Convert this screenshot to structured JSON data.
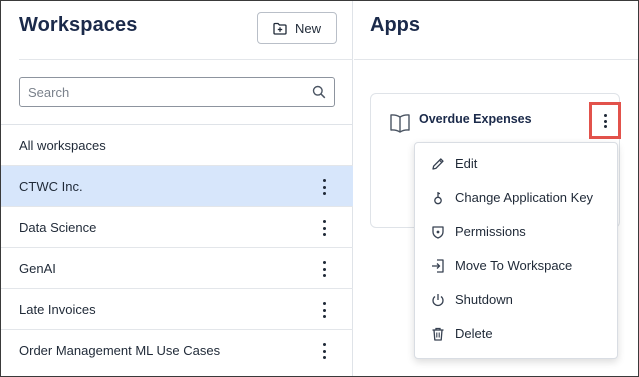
{
  "workspaces": {
    "title": "Workspaces",
    "new_button_label": "New",
    "search_placeholder": "Search",
    "items": [
      {
        "label": "All workspaces",
        "selected": false,
        "has_menu": false
      },
      {
        "label": "CTWC Inc.",
        "selected": true,
        "has_menu": true
      },
      {
        "label": "Data Science",
        "selected": false,
        "has_menu": true
      },
      {
        "label": "GenAI",
        "selected": false,
        "has_menu": true
      },
      {
        "label": "Late Invoices",
        "selected": false,
        "has_menu": true
      },
      {
        "label": "Order Management ML Use Cases",
        "selected": false,
        "has_menu": true
      }
    ]
  },
  "apps": {
    "title": "Apps",
    "cards": [
      {
        "name": "Overdue Expenses",
        "icon": "book-icon"
      }
    ],
    "context_menu": [
      {
        "label": "Edit",
        "icon": "pencil-icon"
      },
      {
        "label": "Change Application Key",
        "icon": "key-icon"
      },
      {
        "label": "Permissions",
        "icon": "shield-icon"
      },
      {
        "label": "Move To Workspace",
        "icon": "move-icon"
      },
      {
        "label": "Shutdown",
        "icon": "power-icon"
      },
      {
        "label": "Delete",
        "icon": "trash-icon"
      }
    ]
  },
  "colors": {
    "selected_row": "#d7e6fb",
    "highlight_border": "#e2524b",
    "title": "#1b2a4a"
  }
}
